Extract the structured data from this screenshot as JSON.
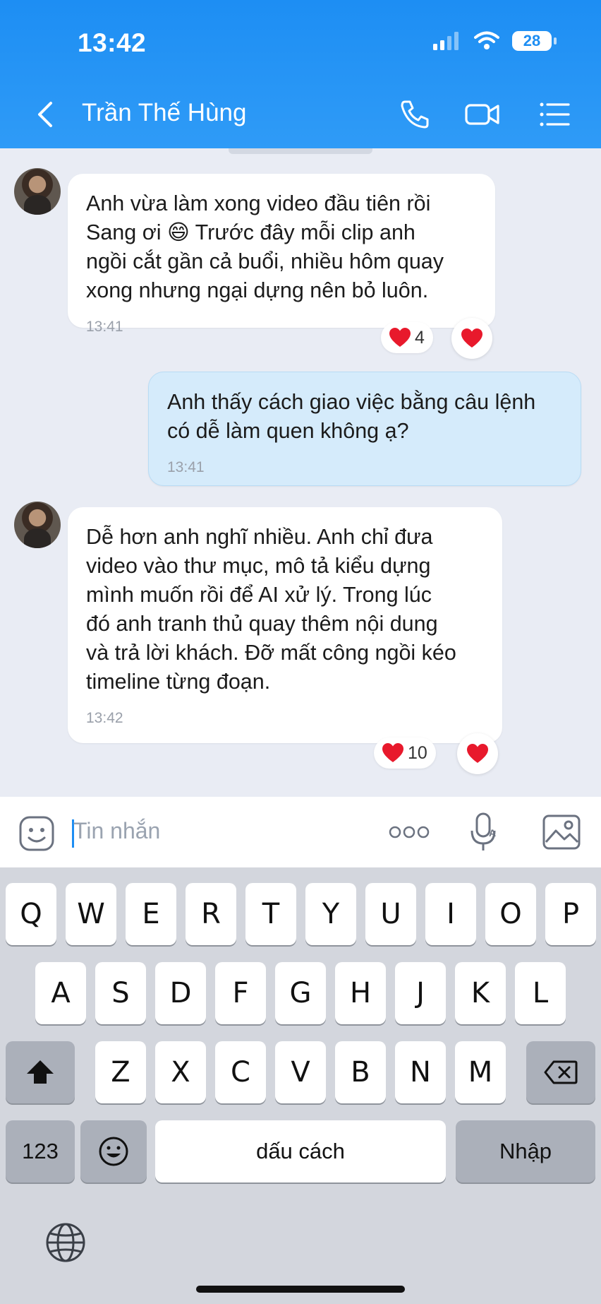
{
  "status": {
    "time": "13:42",
    "battery": "28"
  },
  "header": {
    "title": "Trần Thế Hùng"
  },
  "messages": [
    {
      "sender": "other",
      "text": "Anh vừa làm xong video đầu tiên rồi\nSang ơi 😄 Trước đây mỗi clip anh\nngồi cắt gần cả buổi, nhiều hôm quay\nxong nhưng ngại dựng nên bỏ luôn.",
      "time": "13:41",
      "reaction_count": "4"
    },
    {
      "sender": "me",
      "text": "Anh thấy cách giao việc bằng câu lệnh\ncó dễ làm quen không ạ?",
      "time": "13:41"
    },
    {
      "sender": "other",
      "text": "Dễ hơn anh nghĩ nhiều. Anh chỉ đưa\nvideo vào thư mục, mô tả kiểu dựng\nmình muốn rồi để AI xử lý. Trong lúc\nđó anh tranh thủ quay thêm nội dung\nvà trả lời khách. Đỡ mất công ngồi kéo\ntimeline từng đoạn.",
      "time": "13:42",
      "reaction_count": "10"
    }
  ],
  "composer": {
    "placeholder": "Tin nhắn"
  },
  "keyboard": {
    "row1": [
      "Q",
      "W",
      "E",
      "R",
      "T",
      "Y",
      "U",
      "I",
      "O",
      "P"
    ],
    "row2": [
      "A",
      "S",
      "D",
      "F",
      "G",
      "H",
      "J",
      "K",
      "L"
    ],
    "row3": [
      "Z",
      "X",
      "C",
      "V",
      "B",
      "N",
      "M"
    ],
    "numbers": "123",
    "space": "dấu cách",
    "enter": "Nhập"
  },
  "colors": {
    "header": "#1D8EF3",
    "my_bubble": "#D5EBFB",
    "heart": "#E8192C"
  }
}
